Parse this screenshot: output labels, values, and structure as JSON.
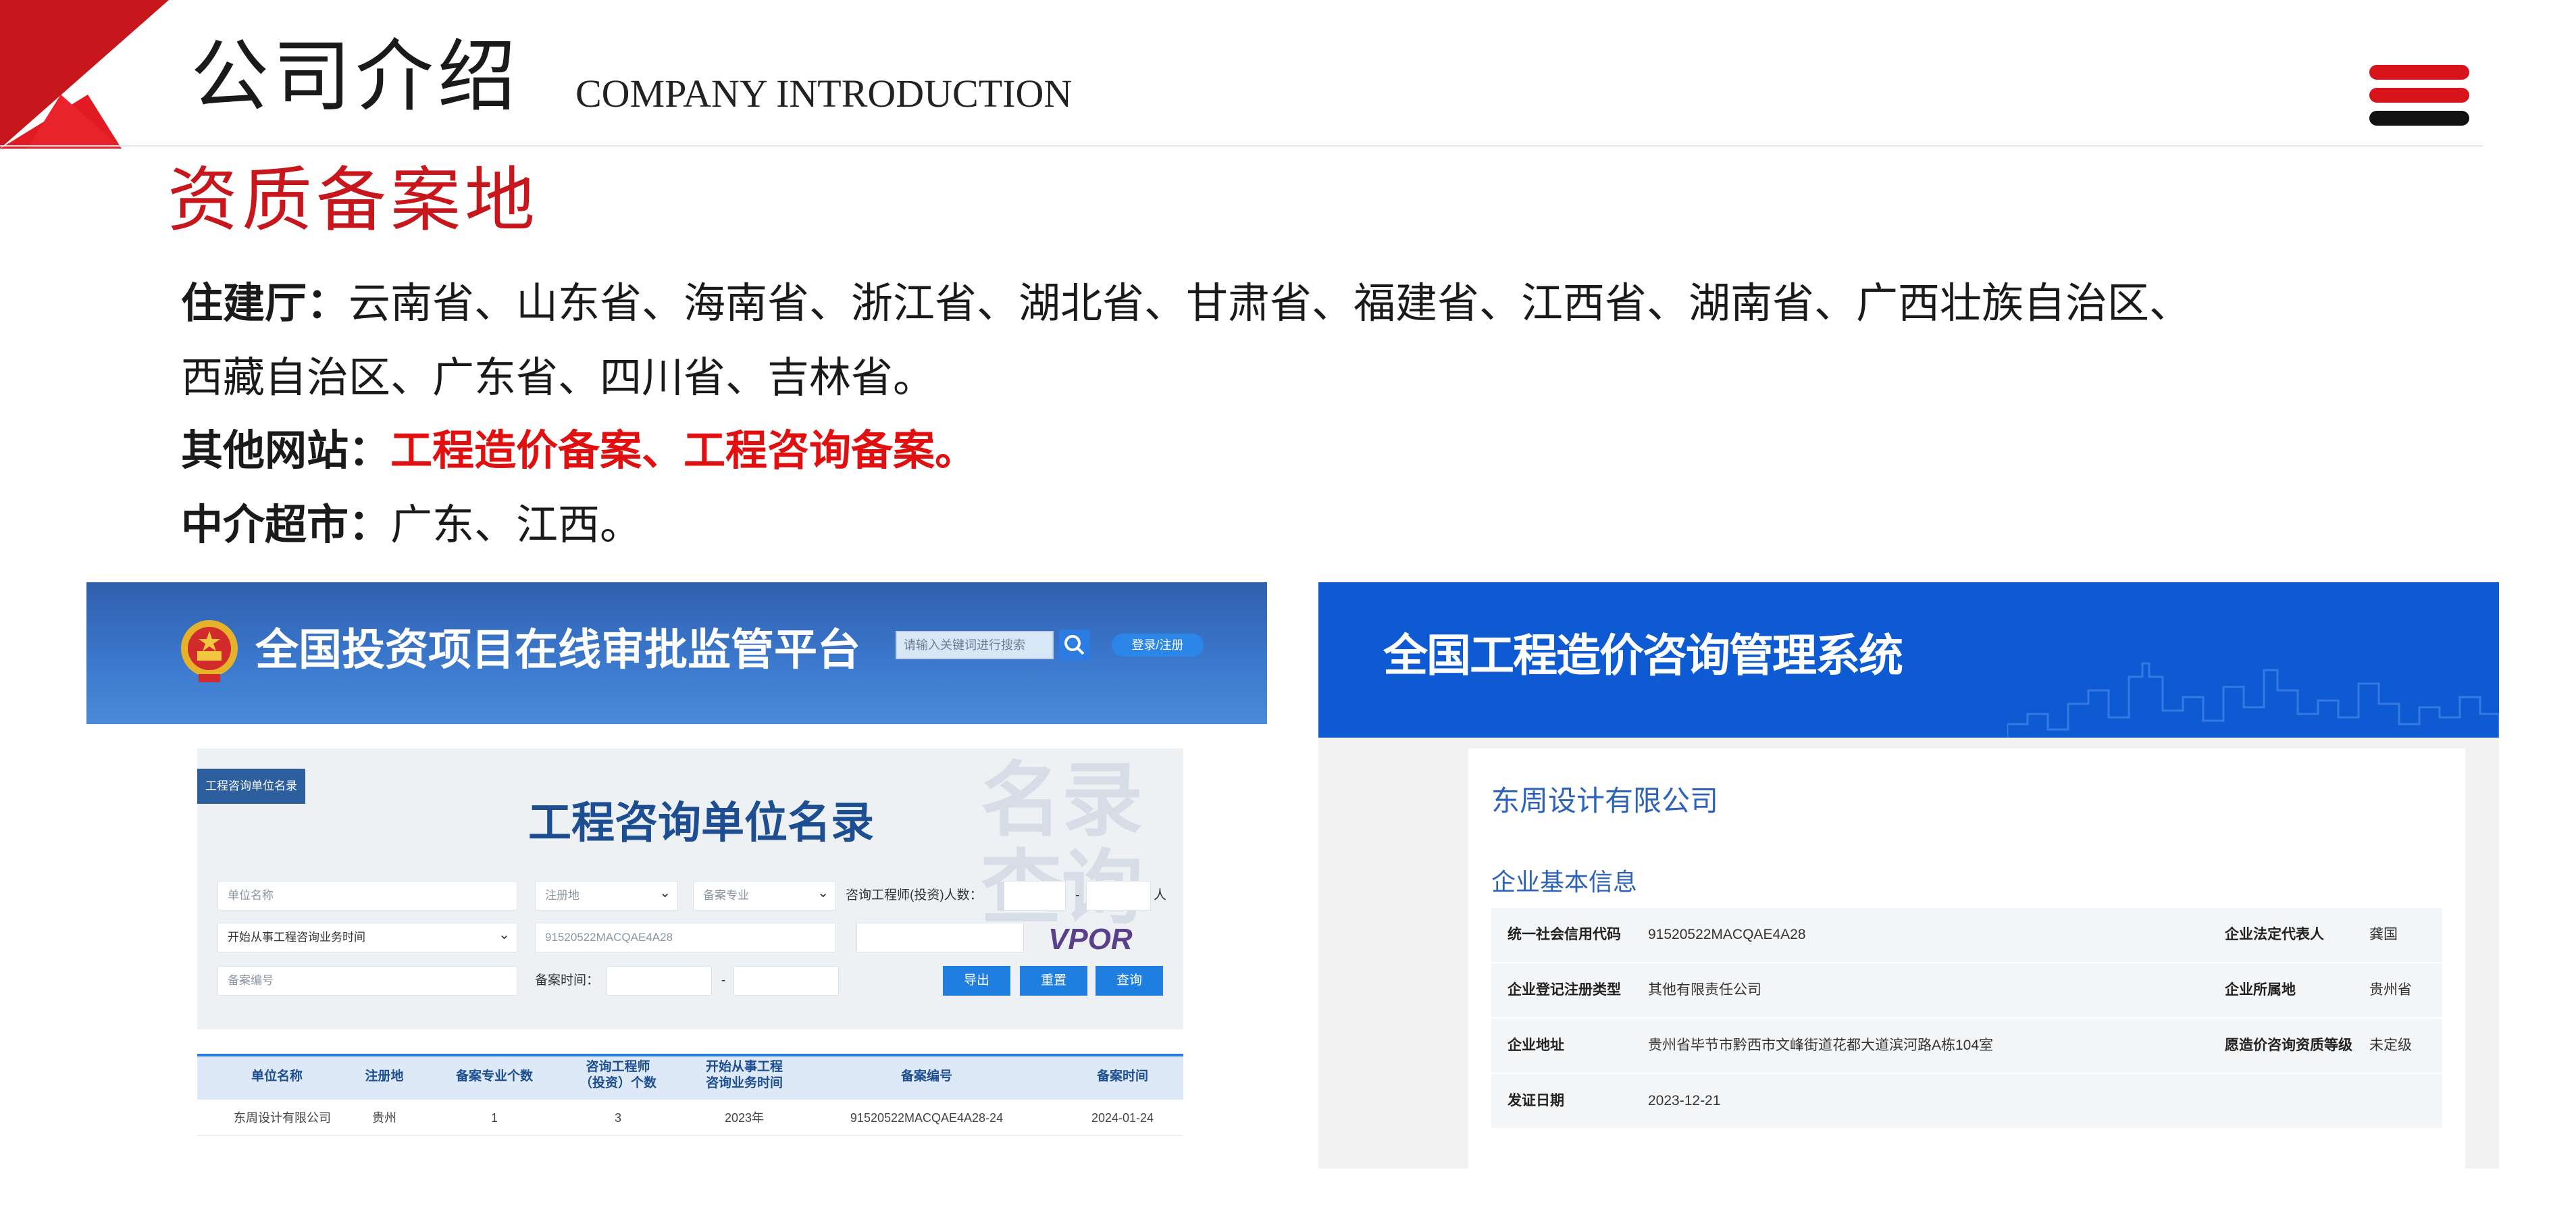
{
  "header": {
    "title_cn": "公司介绍",
    "title_en": "COMPANY INTRODUCTION",
    "accent_color": "#c8161d"
  },
  "section_title": "资质备案地",
  "paragraphs": {
    "housing_label": "住建厅：",
    "housing_text_line1": "云南省、山东省、海南省、浙江省、湖北省、甘肃省、福建省、江西省、湖南省、广西壮族自治区、",
    "housing_text_line2": "西藏自治区、广东省、四川省、吉林省。",
    "other_label": "其他网站：",
    "other_text": "工程造价备案、工程咨询备案。",
    "agency_label": "中介超市：",
    "agency_text": "广东、江西。"
  },
  "left_screenshot": {
    "platform_title": "全国投资项目在线审批监管平台",
    "search_placeholder": "请输入关键词进行搜索",
    "login_label": "登录/注册",
    "tag": "工程咨询单位名录",
    "query_title": "工程咨询单位名录",
    "watermark": "名录查询",
    "fields": {
      "unit_name": "单位名称",
      "reg_place": "注册地",
      "filing_major": "备案专业",
      "engineer_count_label": "咨询工程师(投资)人数：",
      "person_unit": "人",
      "start_time": "开始从事工程咨询业务时间",
      "code_value": "91520522MACQAE4A28",
      "filing_no": "备案编号",
      "filing_time_label": "备案时间：",
      "captcha": "VPOR"
    },
    "buttons": {
      "export": "导出",
      "reset": "重置",
      "query": "查询"
    },
    "table": {
      "headers": [
        "单位名称",
        "注册地",
        "备案专业个数",
        "咨询工程师\n（投资）个数",
        "开始从事工程\n咨询业务时间",
        "备案编号",
        "备案时间"
      ],
      "row": [
        "东周设计有限公司",
        "贵州",
        "1",
        "3",
        "2023年",
        "91520522MACQAE4A28-24",
        "2024-01-24"
      ]
    }
  },
  "right_screenshot": {
    "system_title": "全国工程造价咨询管理系统",
    "company_name": "东周设计有限公司",
    "section": "企业基本信息",
    "rows": [
      {
        "k1": "统一社会信用代码",
        "v1": "91520522MACQAE4A28",
        "k2": "企业法定代表人",
        "v2": "龚国"
      },
      {
        "k1": "企业登记注册类型",
        "v1": "其他有限责任公司",
        "k2": "企业所属地",
        "v2": "贵州省"
      },
      {
        "k1": "企业地址",
        "v1": "贵州省毕节市黔西市文峰街道花都大道滨河路A栋104室",
        "k2": "愿造价咨询资质等级",
        "v2": "未定级"
      },
      {
        "k1": "发证日期",
        "v1": "2023-12-21",
        "k2": "",
        "v2": ""
      }
    ]
  }
}
